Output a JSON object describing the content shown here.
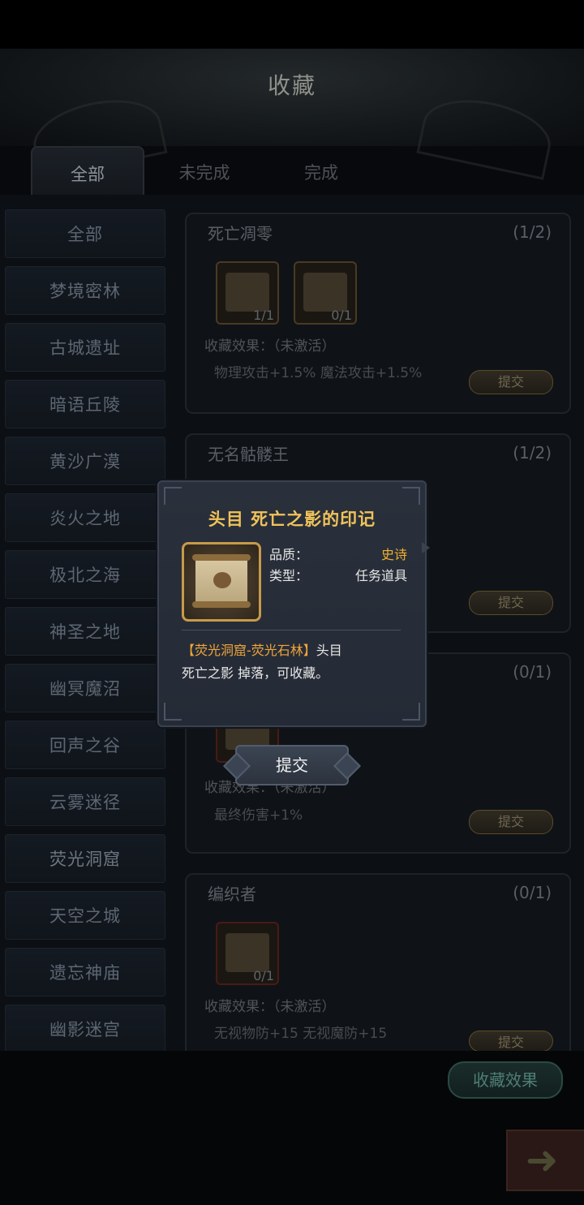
{
  "page": {
    "title": "收藏"
  },
  "tabs": [
    "全部",
    "未完成",
    "完成"
  ],
  "sidebar": [
    "全部",
    "梦境密林",
    "古城遗址",
    "暗语丘陵",
    "黄沙广漠",
    "炎火之地",
    "极北之海",
    "神圣之地",
    "幽冥魔沼",
    "回声之谷",
    "云雾迷径",
    "荧光洞窟",
    "天空之城",
    "遗忘神庙",
    "幽影迷宫"
  ],
  "cards": [
    {
      "name": "死亡凋零",
      "progress": "(1/2)",
      "items": [
        "1/1",
        "0/1"
      ],
      "effect_label": "收藏效果：（未激活）",
      "effect_value": "物理攻击+1.5%  魔法攻击+1.5%",
      "submit": "提交"
    },
    {
      "name": "无名骷髅王",
      "progress": "(1/2)",
      "submit": "提交"
    },
    {
      "progress": "(0/1)",
      "effect_label": "收藏效果：（未激活）",
      "effect_value": "最终伤害+1%",
      "submit": "提交"
    },
    {
      "name": "编织者",
      "progress": "(0/1)",
      "items": [
        "0/1"
      ],
      "effect_label": "收藏效果：（未激活）",
      "effect_value": "无视物防+15  无视魔防+15",
      "submit": "提交"
    }
  ],
  "popup": {
    "title": "头目 死亡之影的印记",
    "quality_label": "品质：",
    "quality_value": "史诗",
    "type_label": "类型：",
    "type_value": "任务道具",
    "desc_highlight": "【荧光洞窟-荧光石林】",
    "desc_line1_rest": "头目",
    "desc_line2": "死亡之影 掉落，可收藏。",
    "submit": "提交"
  },
  "bottom": {
    "collect_effect": "收藏效果"
  },
  "colors": {
    "quality_epic": "#f0b030",
    "title_gold": "#f0c35a",
    "location_orange": "#f0a63a"
  },
  "icons": [
    "scroll-icon",
    "skull-icon",
    "arrow-right-icon"
  ]
}
